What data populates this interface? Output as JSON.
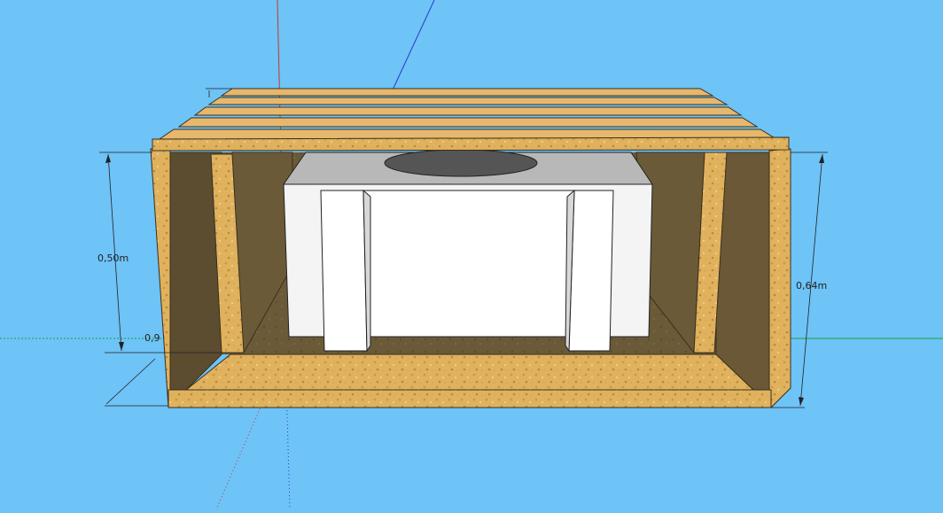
{
  "scene": {
    "background_color": "#6ec3f7",
    "axes": {
      "red": "#c0392b",
      "green": "#1e9e3e",
      "blue": "#2a3cc7"
    },
    "materials": {
      "wood_light": "#e6b86e",
      "wood_dark": "#6b5a38",
      "particle_board": "#e0b25e",
      "foam_white": "#ffffff",
      "foam_top": "#b8b8b8",
      "hole": "#555555"
    }
  },
  "dimensions": {
    "left_height": "0,50m",
    "right_height": "0,64m",
    "depth_partial": "0,9"
  }
}
